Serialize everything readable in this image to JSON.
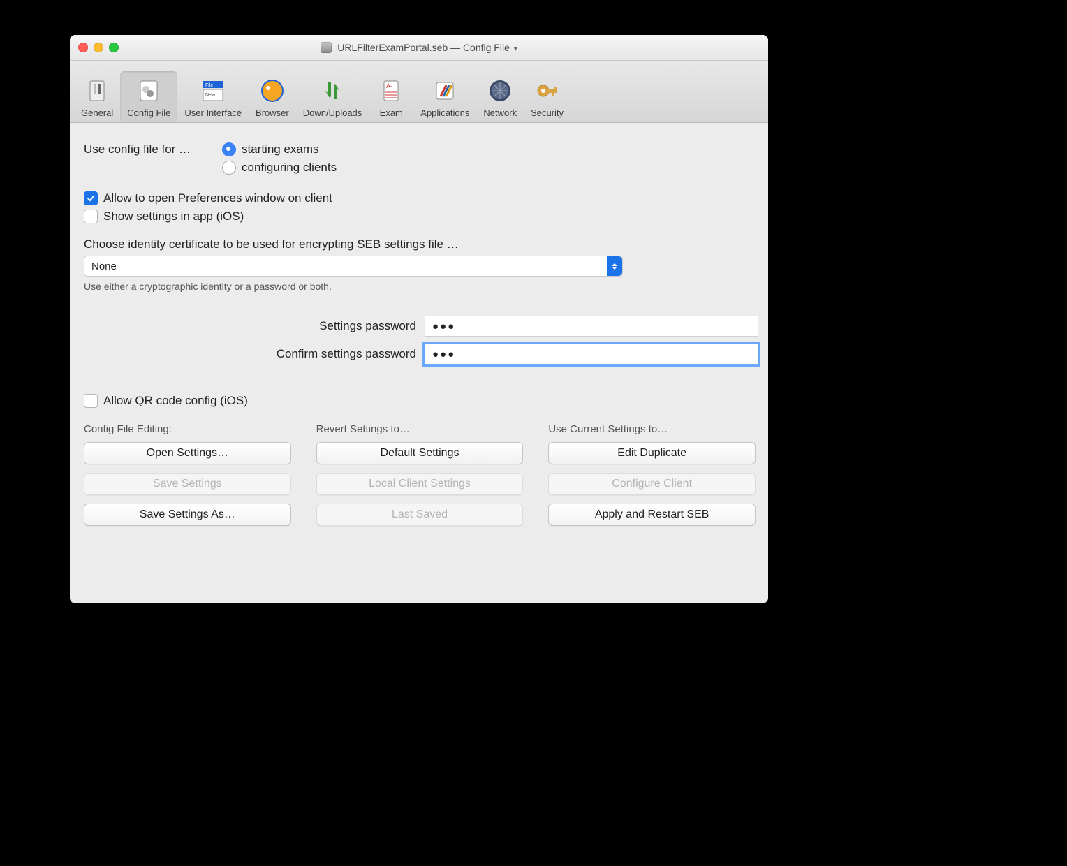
{
  "titlebar": {
    "filename": "URLFilterExamPortal.seb",
    "separator": " — ",
    "section": "Config File"
  },
  "toolbar": {
    "items": [
      {
        "label": "General"
      },
      {
        "label": "Config File"
      },
      {
        "label": "User Interface"
      },
      {
        "label": "Browser"
      },
      {
        "label": "Down/Uploads"
      },
      {
        "label": "Exam"
      },
      {
        "label": "Applications"
      },
      {
        "label": "Network"
      },
      {
        "label": "Security"
      }
    ],
    "active_index": 1
  },
  "use_config": {
    "label": "Use config file for …",
    "options": {
      "starting": "starting exams",
      "configuring": "configuring clients"
    },
    "selected": "starting"
  },
  "check_allow_prefs": {
    "label": "Allow to open Preferences window on client",
    "checked": true
  },
  "check_show_ios": {
    "label": "Show settings in app (iOS)",
    "checked": false
  },
  "cert": {
    "label": "Choose identity certificate to be used for encrypting SEB settings file …",
    "value": "None",
    "hint": "Use either a cryptographic identity or a password or both."
  },
  "pw": {
    "settings_label": "Settings password",
    "confirm_label": "Confirm settings password",
    "settings_value": "●●●",
    "confirm_value": "●●●"
  },
  "check_qr": {
    "label": "Allow QR code config (iOS)",
    "checked": false
  },
  "cols": {
    "editing": {
      "title": "Config File Editing:",
      "open": "Open Settings…",
      "save": "Save Settings",
      "save_as": "Save Settings As…"
    },
    "revert": {
      "title": "Revert Settings to…",
      "default": "Default Settings",
      "local": "Local Client Settings",
      "last": "Last Saved"
    },
    "use": {
      "title": "Use Current Settings to…",
      "edit_dup": "Edit Duplicate",
      "configure": "Configure Client",
      "apply": "Apply and Restart SEB"
    }
  }
}
